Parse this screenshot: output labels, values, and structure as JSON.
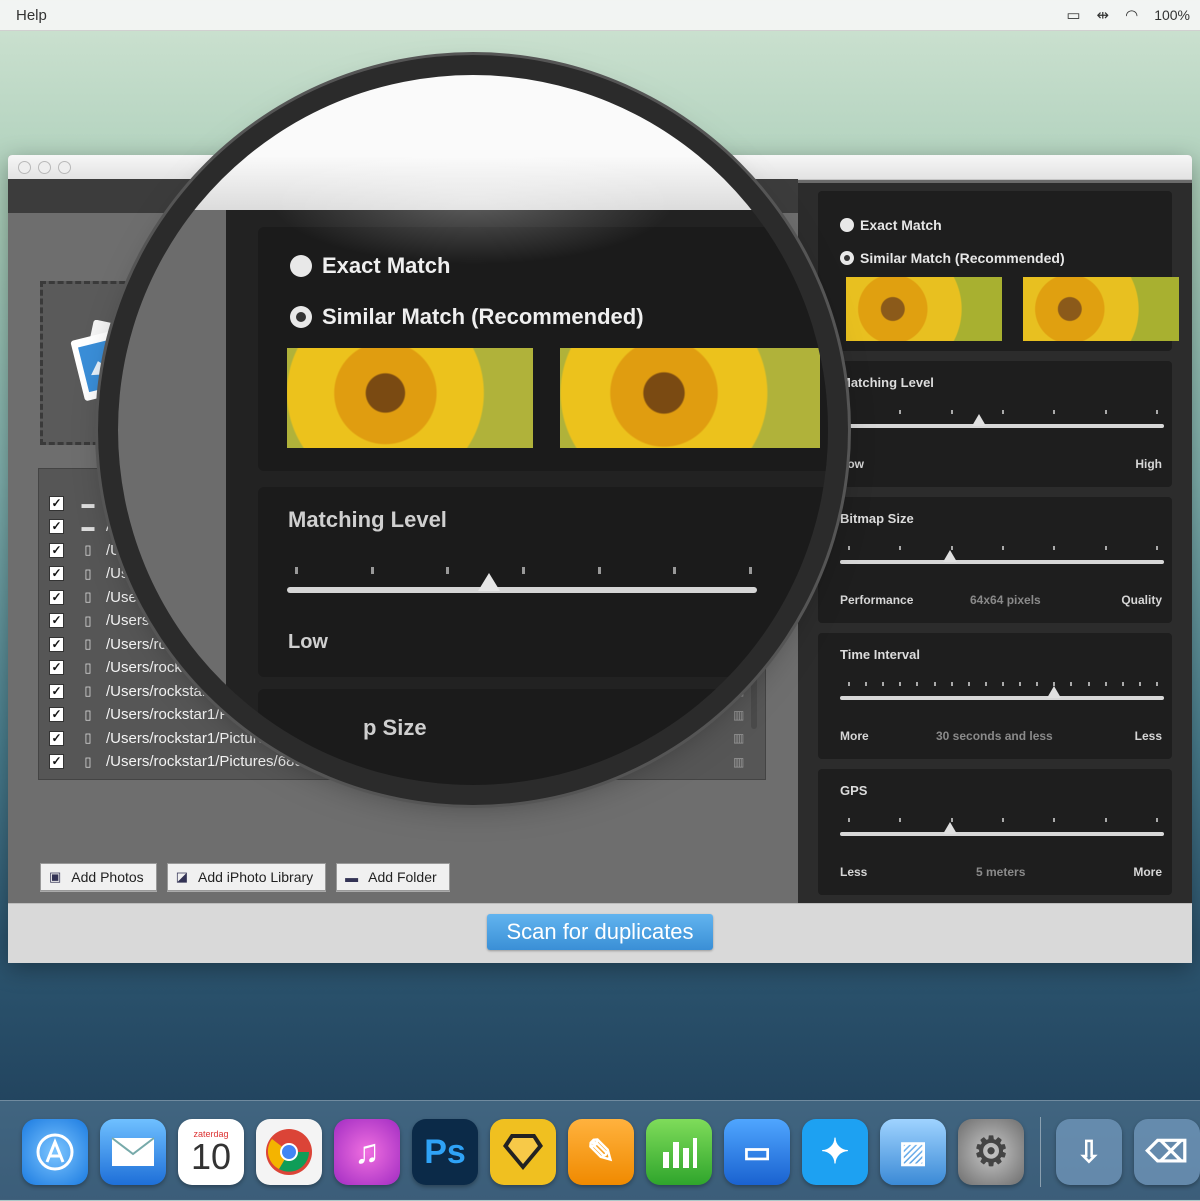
{
  "menubar": {
    "help_label": "Help",
    "battery": "100%",
    "icons": [
      "airplay-icon",
      "arrows-icon",
      "wifi-icon"
    ]
  },
  "magnifier": {
    "exact_match": "Exact Match",
    "similar_match": "Similar Match (Recommended)",
    "selected_mode": "similar",
    "matching_level_title": "Matching Level",
    "low_label": "Low",
    "bitmap_size_partial": "p Size"
  },
  "file_list": {
    "rows": [
      {
        "type": "folder",
        "path": "/U"
      },
      {
        "type": "folder",
        "path": "/U"
      },
      {
        "type": "file",
        "path": "/Us"
      },
      {
        "type": "file",
        "path": "/Use"
      },
      {
        "type": "file",
        "path": "/Users"
      },
      {
        "type": "file",
        "path": "/Users/"
      },
      {
        "type": "file",
        "path": "/Users/ro"
      },
      {
        "type": "file",
        "path": "/Users/rocks"
      },
      {
        "type": "file",
        "path": "/Users/rockstar"
      },
      {
        "type": "file",
        "path": "/Users/rockstar1/Pi"
      },
      {
        "type": "file",
        "path": "/Users/rockstar1/Picture"
      },
      {
        "type": "file",
        "path": "/Users/rockstar1/Pictures/68c"
      }
    ]
  },
  "buttons": {
    "add_photos": "Add Photos",
    "add_iphoto_library": "Add iPhoto Library",
    "add_folder": "Add Folder",
    "scan": "Scan for duplicates"
  },
  "settings": {
    "exact_match": "Exact Match",
    "similar_match": "Similar Match (Recommended)",
    "selected_mode": "similar",
    "matching_level": {
      "title": "Matching Level",
      "left": "Low",
      "right": "High",
      "value": 0.43
    },
    "bitmap_size": {
      "title": "Bitmap Size",
      "left": "Performance",
      "middle": "64x64 pixels",
      "right": "Quality",
      "value": 0.34
    },
    "time_interval": {
      "title": "Time Interval",
      "left": "More",
      "middle": "30 seconds and less",
      "right": "Less",
      "value": 0.66
    },
    "gps": {
      "title": "GPS",
      "left": "Less",
      "middle": "5 meters",
      "right": "More",
      "value": 0.34
    }
  },
  "dock": {
    "calendar_day": "10",
    "calendar_label": "zaterdag",
    "photoshop_label": "Ps",
    "items": [
      "app-store-icon",
      "mail-icon",
      "calendar-icon",
      "chrome-icon",
      "itunes-icon",
      "photoshop-icon",
      "sketch-icon",
      "pages-icon",
      "numbers-icon",
      "keynote-icon",
      "twitter-icon",
      "photos-duplicate-icon",
      "system-preferences-icon",
      "downloads-icon",
      "trash-icon"
    ]
  }
}
